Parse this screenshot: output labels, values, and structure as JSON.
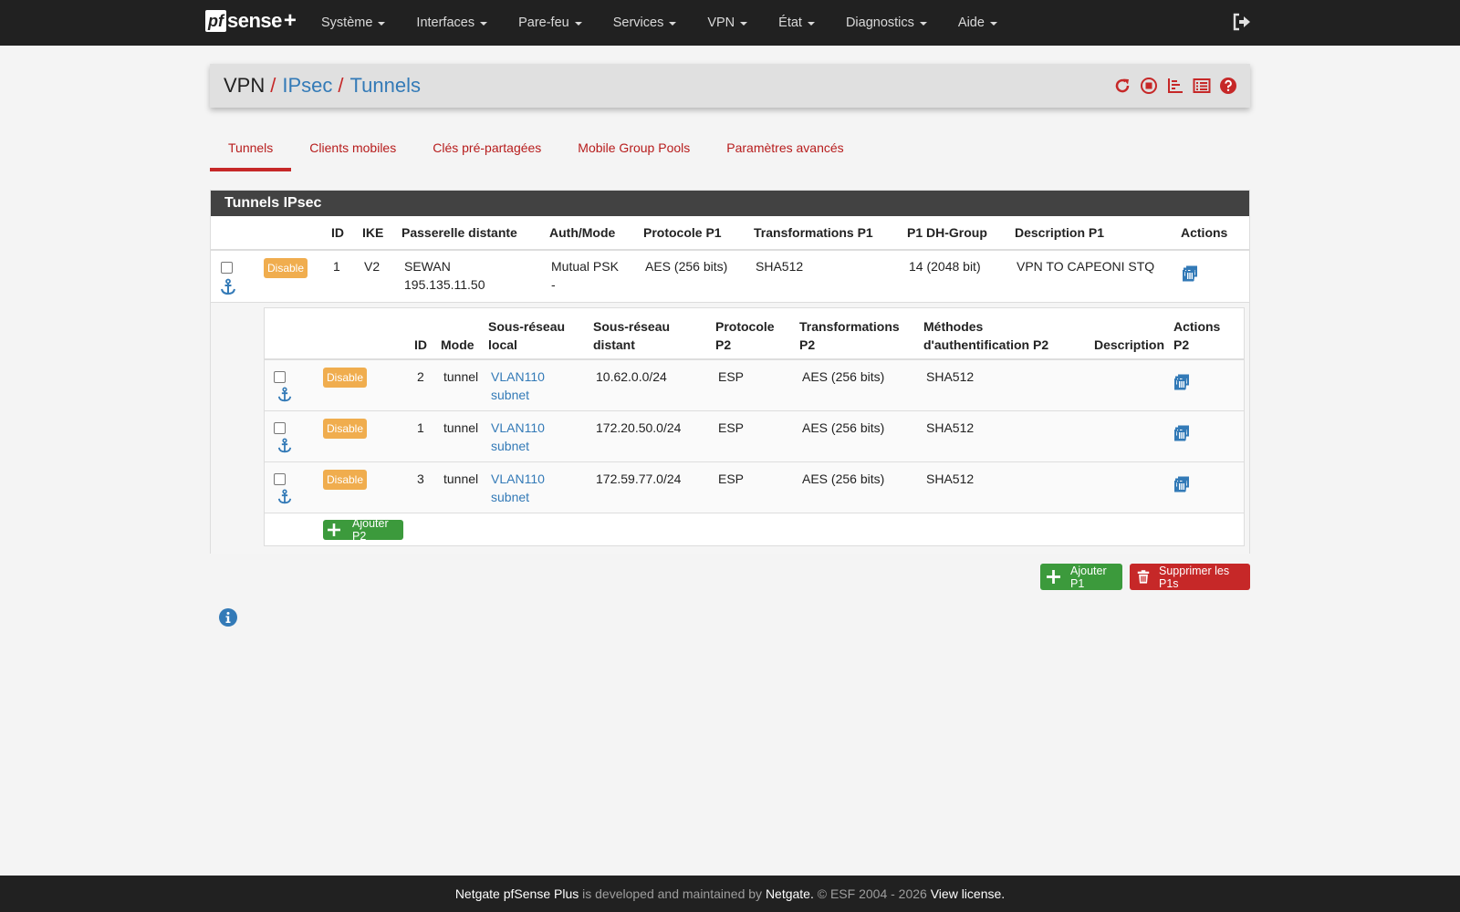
{
  "navbar": {
    "logo": {
      "pf": "pf",
      "sense": "sense",
      "plus": "+"
    },
    "items": [
      {
        "label": "Système"
      },
      {
        "label": "Interfaces"
      },
      {
        "label": "Pare-feu"
      },
      {
        "label": "Services"
      },
      {
        "label": "VPN"
      },
      {
        "label": "État"
      },
      {
        "label": "Diagnostics"
      },
      {
        "label": "Aide"
      }
    ],
    "logout_icon": "sign-out-icon"
  },
  "breadcrumb": {
    "root": "VPN",
    "separator": "/",
    "level2": "IPsec",
    "level3": "Tunnels",
    "icons": [
      "refresh-icon",
      "stop-circle-icon",
      "chart-icon",
      "list-icon",
      "help-icon"
    ]
  },
  "tabs": [
    {
      "label": "Tunnels",
      "active": true
    },
    {
      "label": "Clients mobiles"
    },
    {
      "label": "Clés pré-partagées"
    },
    {
      "label": "Mobile Group Pools"
    },
    {
      "label": "Paramètres avancés"
    }
  ],
  "panel": {
    "title": "Tunnels IPsec",
    "p1_headers": {
      "id": "ID",
      "ike": "IKE",
      "gateway": "Passerelle distante",
      "auth": "Auth/Mode",
      "proto": "Protocole P1",
      "transforms": "Transformations P1",
      "dh": "P1 DH-Group",
      "desc": "Description P1",
      "actions": "Actions"
    },
    "p1_row": {
      "badge": "Disable",
      "id": "1",
      "ike": "V2",
      "gateway_line1": "SEWAN",
      "gateway_line2": "195.135.11.50",
      "auth_line1": "Mutual PSK",
      "auth_line2": "-",
      "proto": "AES (256 bits)",
      "transforms": "SHA512",
      "dh": "14 (2048 bit)",
      "desc": "VPN TO CAPEONI STQ"
    },
    "p2_headers": {
      "id": "ID",
      "mode": "Mode",
      "local_l1": "Sous-réseau",
      "local_l2": "local",
      "remote_l1": "Sous-réseau",
      "remote_l2": "distant",
      "proto_l1": "Protocole",
      "proto_l2": "P2",
      "transforms_l1": "Transformations",
      "transforms_l2": "P2",
      "auth_l1": "Méthodes",
      "auth_l2": "d'authentification P2",
      "desc": "Description",
      "actions_l1": "Actions",
      "actions_l2": "P2"
    },
    "p2_rows": [
      {
        "badge": "Disable",
        "id": "2",
        "mode": "tunnel",
        "local_l1": "VLAN110",
        "local_l2": "subnet",
        "remote": "10.62.0.0/24",
        "proto": "ESP",
        "transforms": "AES (256 bits)",
        "auth": "SHA512",
        "desc": ""
      },
      {
        "badge": "Disable",
        "id": "1",
        "mode": "tunnel",
        "local_l1": "VLAN110",
        "local_l2": "subnet",
        "remote": "172.20.50.0/24",
        "proto": "ESP",
        "transforms": "AES (256 bits)",
        "auth": "SHA512",
        "desc": ""
      },
      {
        "badge": "Disable",
        "id": "3",
        "mode": "tunnel",
        "local_l1": "VLAN110",
        "local_l2": "subnet",
        "remote": "172.59.77.0/24",
        "proto": "ESP",
        "transforms": "AES (256 bits)",
        "auth": "SHA512",
        "desc": ""
      }
    ],
    "add_p2": "Ajouter P2"
  },
  "buttons": {
    "add_p1": "Ajouter P1",
    "delete_p1s": "Supprimer les P1s"
  },
  "info_icon": "info-circle-icon",
  "footer": {
    "product": "Netgate pfSense Plus",
    "text1": " is developed and maintained by ",
    "company": "Netgate.",
    "text2": " © ESF 2004 - 2026 ",
    "license": "View license."
  },
  "colors": {
    "navbar_bg": "#212121",
    "accent_red": "#c62828",
    "link_blue": "#337ab7",
    "badge_orange": "#f0ad4e",
    "button_green": "#3c9a3c"
  }
}
